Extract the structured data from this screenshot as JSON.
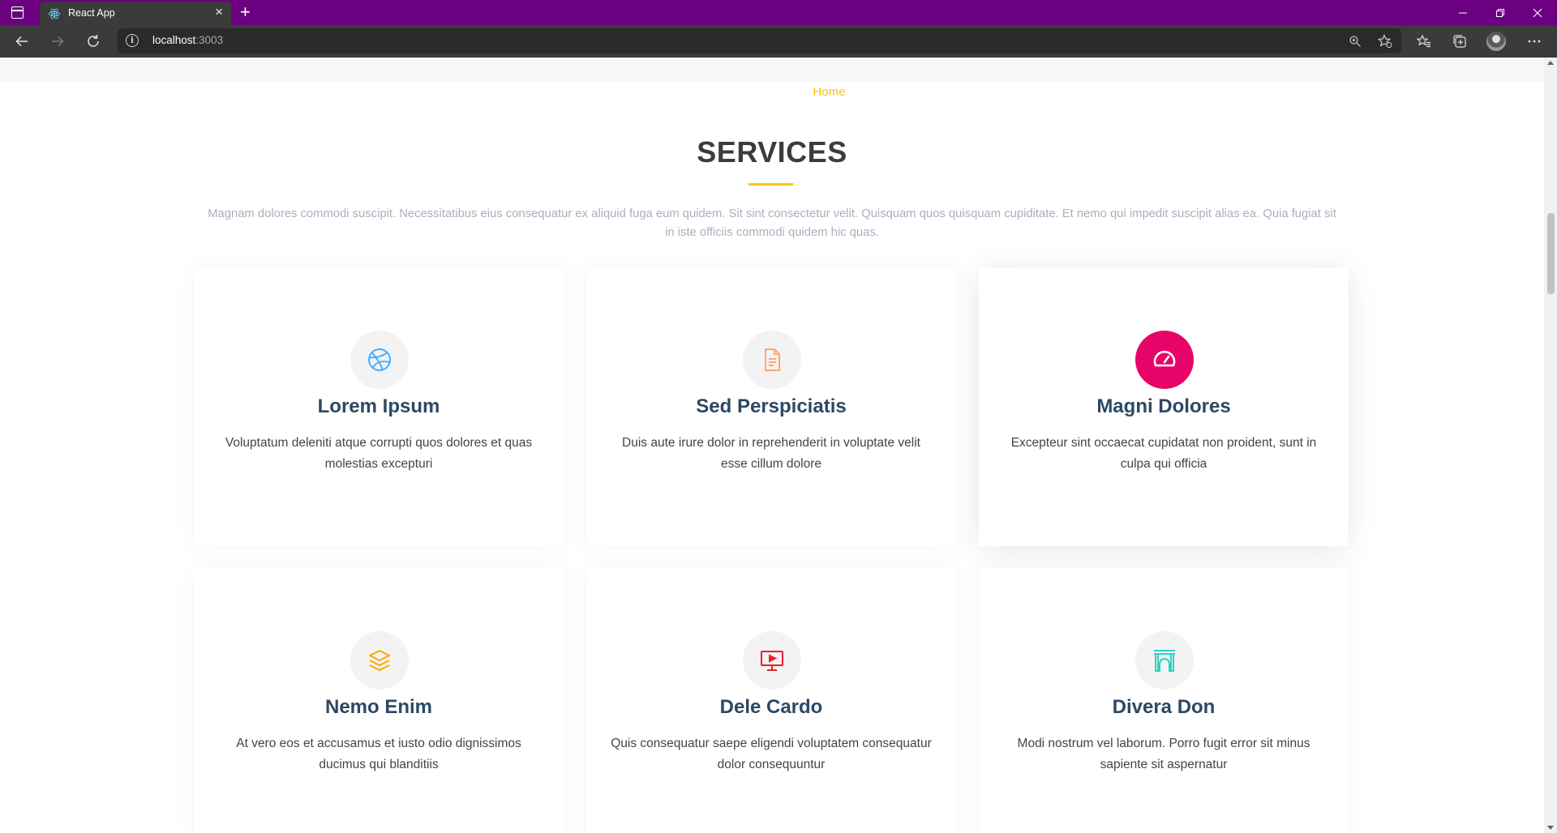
{
  "browser": {
    "tab_title": "React App",
    "tab_close": "×",
    "new_tab": "+",
    "url_host": "localhost",
    "url_port": ":3003",
    "info_glyph": "i"
  },
  "page": {
    "breadcrumb_home": "Home",
    "section_title": "SERVICES",
    "section_description": "Magnam dolores commodi suscipit. Necessitatibus eius consequatur ex aliquid fuga eum quidem. Sit sint consectetur velit. Quisquam quos quisquam cupiditate. Et nemo qui impedit suscipit alias ea. Quia fugiat sit in iste officiis commodi quidem hic quas."
  },
  "services": [
    {
      "title": "Lorem Ipsum",
      "description": "Voluptatum deleniti atque corrupti quos dolores et quas molestias excepturi",
      "icon": "dribbble-icon",
      "icon_color": "#47aeff"
    },
    {
      "title": "Sed Perspiciatis",
      "description": "Duis aute irure dolor in reprehenderit in voluptate velit esse cillum dolore",
      "icon": "file-icon",
      "icon_color": "#ffa76e"
    },
    {
      "title": "Magni Dolores",
      "description": "Excepteur sint occaecat cupidatat non proident, sunt in culpa qui officia",
      "icon": "speedometer-icon",
      "icon_color": "#ffffff"
    },
    {
      "title": "Nemo Enim",
      "description": "At vero eos et accusamus et iusto odio dignissimos ducimus qui blanditiis",
      "icon": "layers-icon",
      "icon_color": "#ffa700"
    },
    {
      "title": "Dele Cardo",
      "description": "Quis consequatur saepe eligendi voluptatem consequatur dolor consequuntur",
      "icon": "presentation-icon",
      "icon_color": "#e9222c"
    },
    {
      "title": "Divera Don",
      "description": "Modi nostrum vel laborum. Porro fugit error sit minus sapiente sit aspernatur",
      "icon": "arch-icon",
      "icon_color": "#2cd3c6"
    }
  ],
  "colors": {
    "accent": "#ffc107",
    "titlebar": "#6b0080",
    "active_icon_bg": "#e80368",
    "card_title": "#2c4964"
  }
}
